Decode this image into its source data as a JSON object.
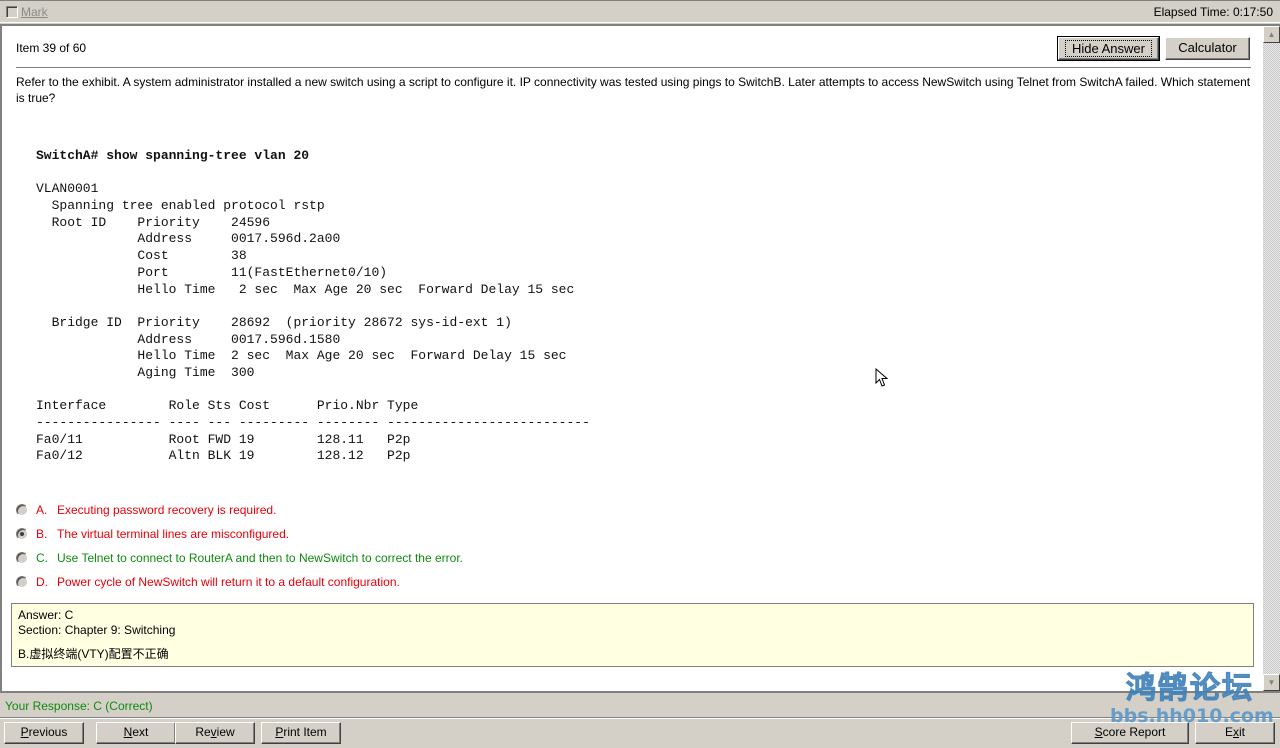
{
  "topbar": {
    "mark_label": "Mark",
    "elapsed_time": "Elapsed Time: 0:17:50"
  },
  "header": {
    "item_counter": "Item 39 of 60",
    "hide_answer_label": "Hide Answer",
    "calculator_label": "Calculator"
  },
  "question": {
    "text": "Refer to the exhibit. A system administrator installed a new switch using a script to configure it. IP connectivity was tested using pings to SwitchB. Later attempts to access NewSwitch using Telnet from SwitchA failed. Which statement is true?"
  },
  "exhibit": {
    "command": "SwitchA# show spanning-tree vlan 20",
    "lines": [
      "VLAN0001",
      "  Spanning tree enabled protocol rstp",
      "  Root ID    Priority    24596",
      "             Address     0017.596d.2a00",
      "             Cost        38",
      "             Port        11(FastEthernet0/10)",
      "             Hello Time   2 sec  Max Age 20 sec  Forward Delay 15 sec",
      "",
      "  Bridge ID  Priority    28692  (priority 28672 sys-id-ext 1)",
      "             Address     0017.596d.1580",
      "             Hello Time  2 sec  Max Age 20 sec  Forward Delay 15 sec",
      "             Aging Time  300",
      "",
      "Interface        Role Sts Cost      Prio.Nbr Type",
      "---------------- ---- --- --------- -------- --------------------------",
      "Fa0/11           Root FWD 19        128.11   P2p",
      "Fa0/12           Altn BLK 19        128.12   P2p"
    ]
  },
  "answers": [
    {
      "letter": "A.",
      "text": "Executing password recovery is required.",
      "color": "#e8000b",
      "selected": false
    },
    {
      "letter": "B.",
      "text": "The virtual terminal lines are misconfigured.",
      "color": "#e8000b",
      "selected": true
    },
    {
      "letter": "C.",
      "text": "Use Telnet to connect to RouterA and then to NewSwitch to correct the error.",
      "color": "#0f8a0f",
      "selected": false
    },
    {
      "letter": "D.",
      "text": "Power cycle of NewSwitch will return it to a default configuration.",
      "color": "#e8000b",
      "selected": false
    }
  ],
  "answer_box": {
    "answer": "Answer: C",
    "section": "Section: Chapter 9: Switching",
    "note": "B.虚拟终端(VTY)配置不正确"
  },
  "response": {
    "text": "Your Response: C (Correct)"
  },
  "footer": {
    "previous": {
      "u": "P",
      "rest": "revious"
    },
    "next": {
      "u": "N",
      "rest": "ext"
    },
    "review": {
      "pre": "Re",
      "u": "v",
      "rest": "iew"
    },
    "print": {
      "u": "P",
      "rest": "rint Item"
    },
    "score": {
      "u": "S",
      "rest": "core Report"
    },
    "exit": {
      "pre": "E",
      "u": "x",
      "rest": "it"
    }
  },
  "watermark": {
    "title": "鸿鹄论坛",
    "url": "bbs.hh010.com"
  }
}
